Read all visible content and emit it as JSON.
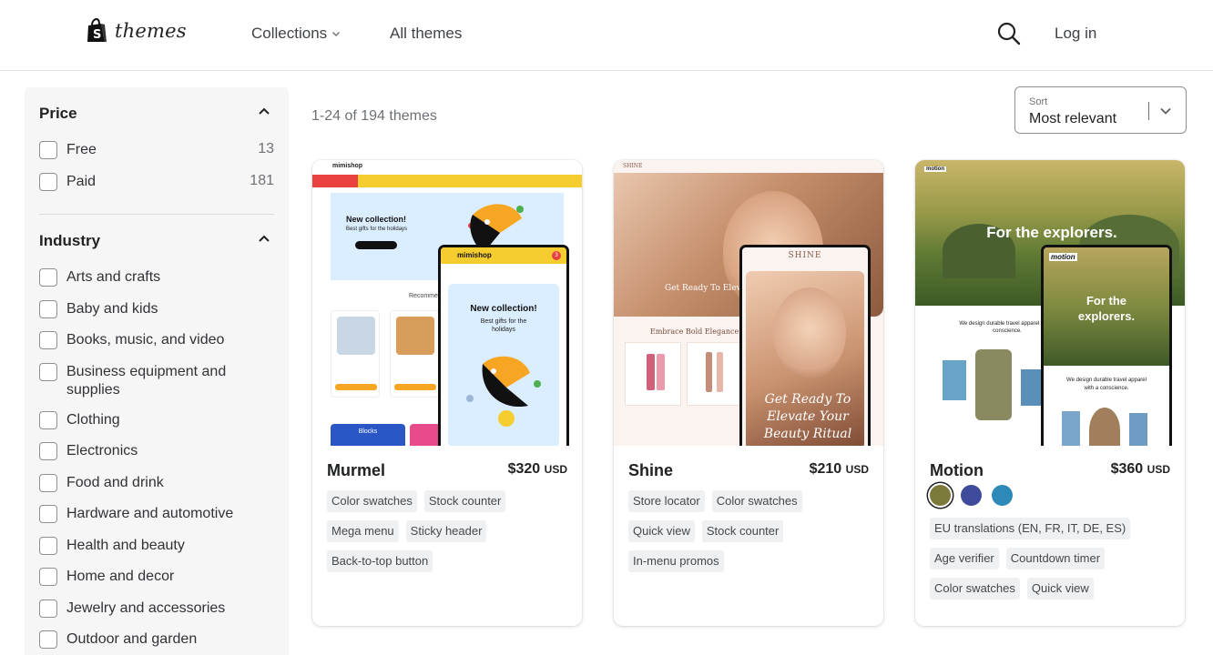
{
  "header": {
    "logo_text": "themes",
    "nav": [
      {
        "label": "Collections"
      },
      {
        "label": "All themes"
      }
    ],
    "login_label": "Log in"
  },
  "sidebar": {
    "price": {
      "title": "Price",
      "options": [
        {
          "label": "Free",
          "count": "13"
        },
        {
          "label": "Paid",
          "count": "181"
        }
      ]
    },
    "industry": {
      "title": "Industry",
      "options": [
        {
          "label": "Arts and crafts"
        },
        {
          "label": "Baby and kids"
        },
        {
          "label": "Books, music, and video"
        },
        {
          "label": "Business equipment and supplies"
        },
        {
          "label": "Clothing"
        },
        {
          "label": "Electronics"
        },
        {
          "label": "Food and drink"
        },
        {
          "label": "Hardware and automotive"
        },
        {
          "label": "Health and beauty"
        },
        {
          "label": "Home and decor"
        },
        {
          "label": "Jewelry and accessories"
        },
        {
          "label": "Outdoor and garden"
        }
      ]
    }
  },
  "results": {
    "count_text": "1-24 of 194 themes",
    "sort_label": "Sort",
    "sort_value": "Most relevant"
  },
  "cards": [
    {
      "name": "Murmel",
      "price": "$320",
      "currency": "USD",
      "tags": [
        "Color swatches",
        "Stock counter",
        "Mega menu",
        "Sticky header",
        "Back-to-top button"
      ],
      "preview": {
        "brand": "mimishop",
        "headline": "New collection!",
        "subline": "Best gifts for the holidays",
        "phone_subline": "Best gifts for the holidays",
        "section_label": "Recommended",
        "blocks_label": "Blocks",
        "phone_cart_count": "3"
      }
    },
    {
      "name": "Shine",
      "price": "$210",
      "currency": "USD",
      "tags": [
        "Store locator",
        "Color swatches",
        "Quick view",
        "Stock counter",
        "In-menu promos"
      ],
      "preview": {
        "brand": "SHINE",
        "desk_headline": "Get Ready To Elevate",
        "section_title": "Embrace Bold Elegance with",
        "phone_headline": "Get Ready To Elevate Your Beauty Ritual"
      }
    },
    {
      "name": "Motion",
      "price": "$360",
      "currency": "USD",
      "swatches": [
        "#7c7a3a",
        "#3e4a9a",
        "#2d8ab8"
      ],
      "tags": [
        "EU translations (EN, FR, IT, DE, ES)",
        "Age verifier",
        "Countdown timer",
        "Color swatches",
        "Quick view"
      ],
      "preview": {
        "brand": "motion",
        "headline": "For the explorers.",
        "desk_body": "We design durable travel apparel with a conscience.",
        "phone_headline": "For the explorers.",
        "phone_body": "We design durable travel apparel with a conscience."
      }
    }
  ]
}
